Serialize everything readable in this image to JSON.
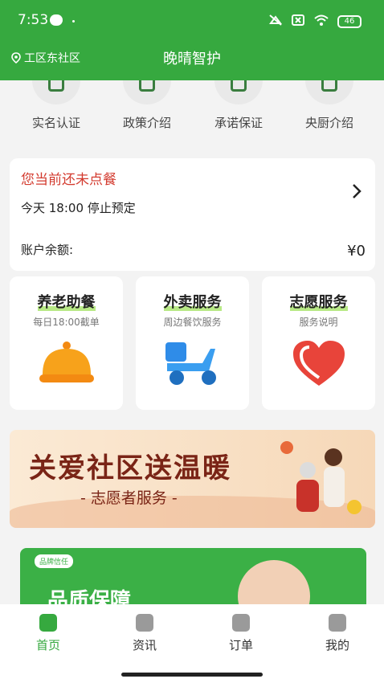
{
  "status": {
    "time": "7:53",
    "battery": "46"
  },
  "header": {
    "location": "工区东社区",
    "title": "晚晴智护"
  },
  "quick_links": [
    {
      "label": "实名认证",
      "icon": "id-verify-icon"
    },
    {
      "label": "政策介绍",
      "icon": "policy-icon"
    },
    {
      "label": "承诺保证",
      "icon": "promise-icon"
    },
    {
      "label": "央厨介绍",
      "icon": "kitchen-icon"
    }
  ],
  "order_card": {
    "warning": "您当前还未点餐",
    "stop_time": "今天 18:00 停止预定",
    "balance_label": "账户余额:",
    "balance_value": "¥0"
  },
  "services": [
    {
      "title": "养老助餐",
      "subtitle": "每日18:00截单",
      "icon": "meal-cover-icon"
    },
    {
      "title": "外卖服务",
      "subtitle": "周边餐饮服务",
      "icon": "scooter-icon"
    },
    {
      "title": "志愿服务",
      "subtitle": "服务说明",
      "icon": "heart-icon"
    }
  ],
  "banner": {
    "title": "关爱社区送温暖",
    "subtitle": "- 志愿者服务 -"
  },
  "promo": {
    "tag": "品牌信任",
    "headline": "品质保障"
  },
  "tabs": [
    {
      "label": "首页",
      "icon": "home-icon"
    },
    {
      "label": "资讯",
      "icon": "news-icon"
    },
    {
      "label": "订单",
      "icon": "order-icon"
    },
    {
      "label": "我的",
      "icon": "profile-icon"
    }
  ],
  "colors": {
    "primary": "#36a93f",
    "warning": "#d33b2f"
  }
}
